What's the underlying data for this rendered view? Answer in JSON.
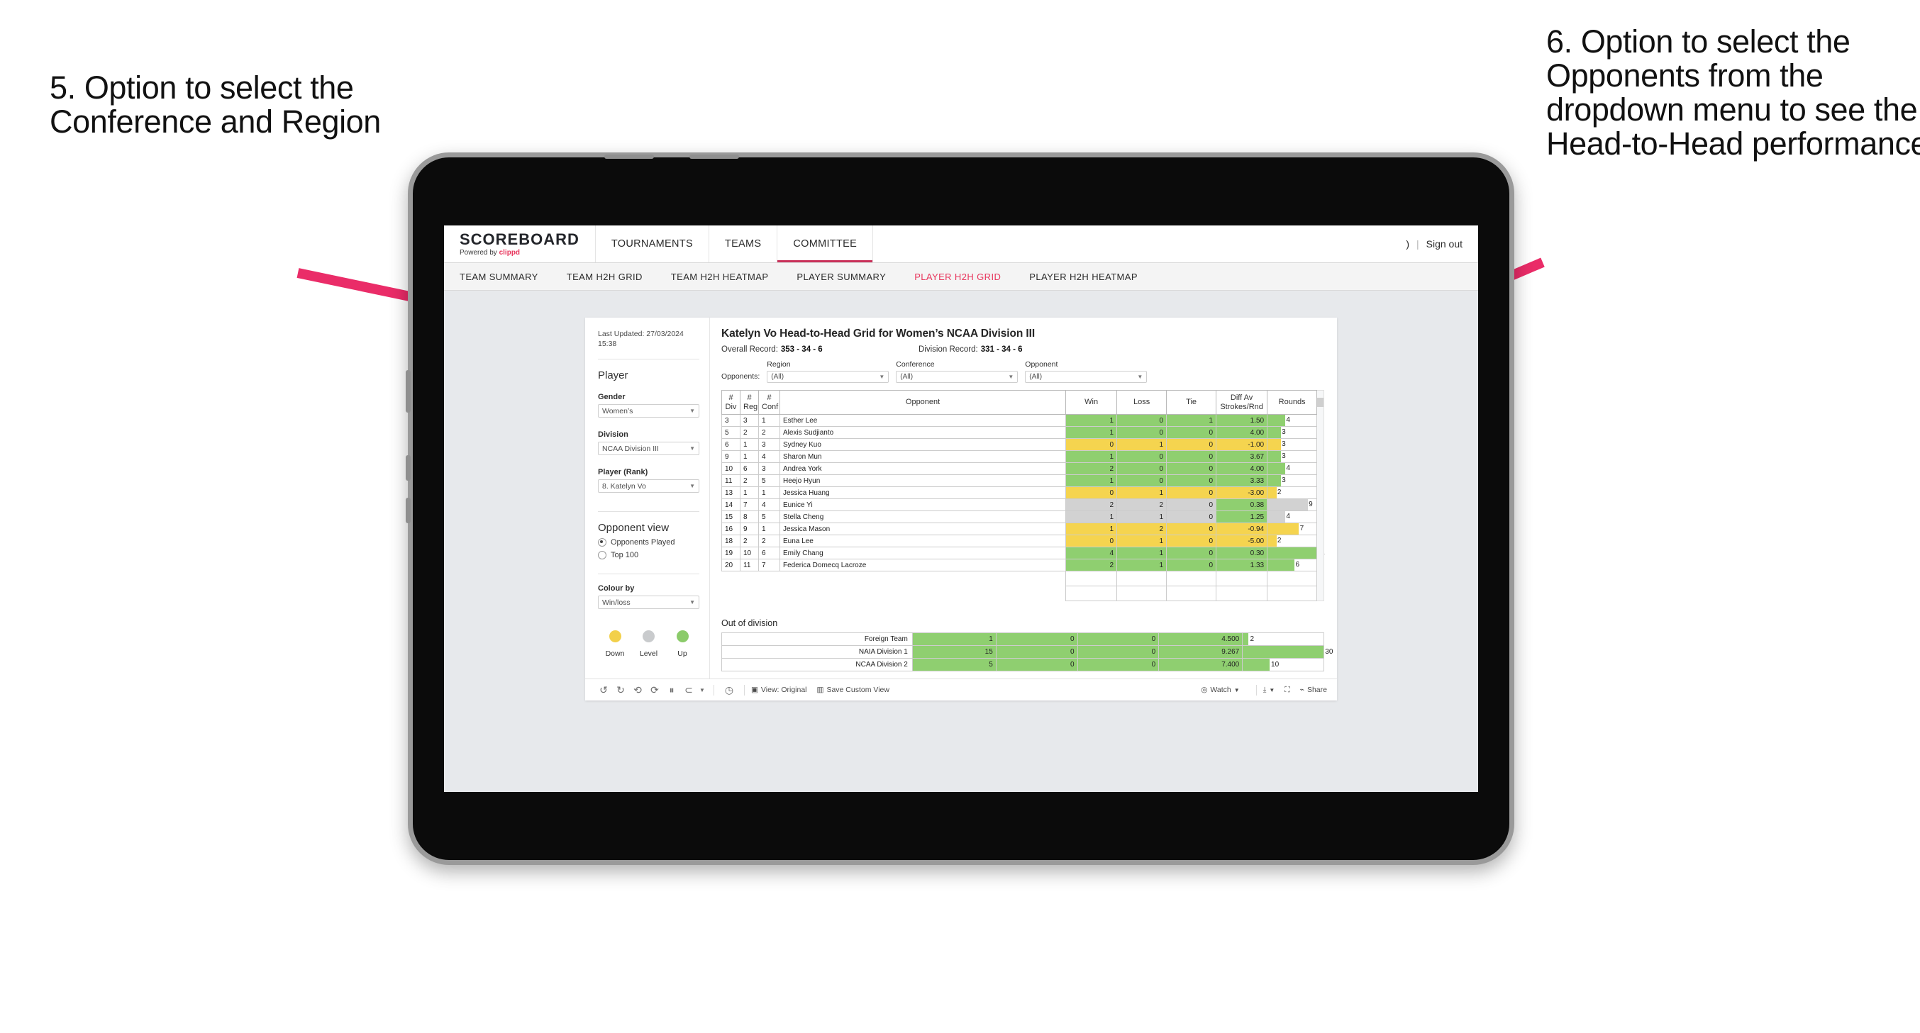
{
  "annotations": {
    "left": "5. Option to select the Conference and Region",
    "right": "6. Option to select the Opponents from the dropdown menu to see the Head-to-Head performance",
    "arrow_color": "#ea2c68"
  },
  "header": {
    "brand_title": "SCOREBOARD",
    "brand_sub_prefix": "Powered by ",
    "brand_sub_name": "clippd",
    "nav": [
      {
        "label": "TOURNAMENTS",
        "active": false
      },
      {
        "label": "TEAMS",
        "active": false
      },
      {
        "label": "COMMITTEE",
        "active": true
      }
    ],
    "user_glyph": ")",
    "separator": "|",
    "sign_out": "Sign out"
  },
  "subnav": {
    "items": [
      {
        "label": "TEAM SUMMARY",
        "active": false
      },
      {
        "label": "TEAM H2H GRID",
        "active": false
      },
      {
        "label": "TEAM H2H HEATMAP",
        "active": false
      },
      {
        "label": "PLAYER SUMMARY",
        "active": false
      },
      {
        "label": "PLAYER H2H GRID",
        "active": true
      },
      {
        "label": "PLAYER H2H HEATMAP",
        "active": false
      }
    ],
    "active_color": "#e8365d"
  },
  "filters": {
    "last_updated": "Last Updated: 27/03/2024 15:38",
    "panel_title": "Player",
    "gender": {
      "label": "Gender",
      "value": "Women’s"
    },
    "division": {
      "label": "Division",
      "value": "NCAA Division III"
    },
    "player_rank": {
      "label": "Player (Rank)",
      "value": "8. Katelyn Vo"
    },
    "opponent_view": {
      "label": "Opponent view",
      "options": [
        {
          "label": "Opponents Played",
          "selected": true
        },
        {
          "label": "Top 100",
          "selected": false
        }
      ]
    },
    "colour_by": {
      "label": "Colour by",
      "value": "Win/loss"
    },
    "legend": [
      {
        "label": "Down",
        "color": "#f2d04b"
      },
      {
        "label": "Level",
        "color": "#c9cbcd"
      },
      {
        "label": "Up",
        "color": "#8bcb6a"
      }
    ]
  },
  "main": {
    "title": "Katelyn Vo Head-to-Head Grid for Women’s NCAA Division III",
    "overall_record_label": "Overall Record:",
    "overall_record_value": "353 - 34 - 6",
    "division_record_label": "Division Record:",
    "division_record_value": "331 - 34 - 6",
    "opponents_label": "Opponents:",
    "dropdowns": [
      {
        "label": "Region",
        "value": "(All)"
      },
      {
        "label": "Conference",
        "value": "(All)"
      },
      {
        "label": "Opponent",
        "value": "(All)"
      }
    ]
  },
  "chart_data": {
    "type": "table",
    "title": "Katelyn Vo Head-to-Head Grid for Women’s NCAA Division III",
    "columns": [
      "# Div",
      "# Reg",
      "# Conf",
      "Opponent",
      "Win",
      "Loss",
      "Tie",
      "Diff Av Strokes/Rnd",
      "Rounds"
    ],
    "rounds_max": 11,
    "rows": [
      {
        "div": "3",
        "reg": "3",
        "conf": "1",
        "opponent": "Esther Lee",
        "win": "1",
        "loss": "0",
        "tie": "1",
        "diff": "1.50",
        "rounds": "4",
        "colour": "g"
      },
      {
        "div": "5",
        "reg": "2",
        "conf": "2",
        "opponent": "Alexis Sudjianto",
        "win": "1",
        "loss": "0",
        "tie": "0",
        "diff": "4.00",
        "rounds": "3",
        "colour": "g"
      },
      {
        "div": "6",
        "reg": "1",
        "conf": "3",
        "opponent": "Sydney Kuo",
        "win": "0",
        "loss": "1",
        "tie": "0",
        "diff": "-1.00",
        "rounds": "3",
        "colour": "y"
      },
      {
        "div": "9",
        "reg": "1",
        "conf": "4",
        "opponent": "Sharon Mun",
        "win": "1",
        "loss": "0",
        "tie": "0",
        "diff": "3.67",
        "rounds": "3",
        "colour": "g"
      },
      {
        "div": "10",
        "reg": "6",
        "conf": "3",
        "opponent": "Andrea York",
        "win": "2",
        "loss": "0",
        "tie": "0",
        "diff": "4.00",
        "rounds": "4",
        "colour": "g"
      },
      {
        "div": "11",
        "reg": "2",
        "conf": "5",
        "opponent": "Heejo Hyun",
        "win": "1",
        "loss": "0",
        "tie": "0",
        "diff": "3.33",
        "rounds": "3",
        "colour": "g"
      },
      {
        "div": "13",
        "reg": "1",
        "conf": "1",
        "opponent": "Jessica Huang",
        "win": "0",
        "loss": "1",
        "tie": "0",
        "diff": "-3.00",
        "rounds": "2",
        "colour": "y"
      },
      {
        "div": "14",
        "reg": "7",
        "conf": "4",
        "opponent": "Eunice Yi",
        "win": "2",
        "loss": "2",
        "tie": "0",
        "diff": "0.38",
        "rounds": "9",
        "colour": "n",
        "diff_colour": "g"
      },
      {
        "div": "15",
        "reg": "8",
        "conf": "5",
        "opponent": "Stella Cheng",
        "win": "1",
        "loss": "1",
        "tie": "0",
        "diff": "1.25",
        "rounds": "4",
        "colour": "n",
        "diff_colour": "g"
      },
      {
        "div": "16",
        "reg": "9",
        "conf": "1",
        "opponent": "Jessica Mason",
        "win": "1",
        "loss": "2",
        "tie": "0",
        "diff": "-0.94",
        "rounds": "7",
        "colour": "y"
      },
      {
        "div": "18",
        "reg": "2",
        "conf": "2",
        "opponent": "Euna Lee",
        "win": "0",
        "loss": "1",
        "tie": "0",
        "diff": "-5.00",
        "rounds": "2",
        "colour": "y"
      },
      {
        "div": "19",
        "reg": "10",
        "conf": "6",
        "opponent": "Emily Chang",
        "win": "4",
        "loss": "1",
        "tie": "0",
        "diff": "0.30",
        "rounds": "11",
        "colour": "g"
      },
      {
        "div": "20",
        "reg": "11",
        "conf": "7",
        "opponent": "Federica Domecq Lacroze",
        "win": "2",
        "loss": "1",
        "tie": "0",
        "diff": "1.33",
        "rounds": "6",
        "colour": "g"
      }
    ]
  },
  "out_of_division": {
    "title": "Out of division",
    "rounds_max": 30,
    "rows": [
      {
        "name": "Foreign Team",
        "win": "1",
        "loss": "0",
        "tie": "0",
        "diff": "4.500",
        "rounds": "2",
        "colour": "g"
      },
      {
        "name": "NAIA Division 1",
        "win": "15",
        "loss": "0",
        "tie": "0",
        "diff": "9.267",
        "rounds": "30",
        "colour": "g"
      },
      {
        "name": "NCAA Division 2",
        "win": "5",
        "loss": "0",
        "tie": "0",
        "diff": "7.400",
        "rounds": "10",
        "colour": "g"
      }
    ]
  },
  "toolbar": {
    "view_label": "View: Original",
    "save_label": "Save Custom View",
    "watch_label": "Watch",
    "share_label": "Share"
  }
}
